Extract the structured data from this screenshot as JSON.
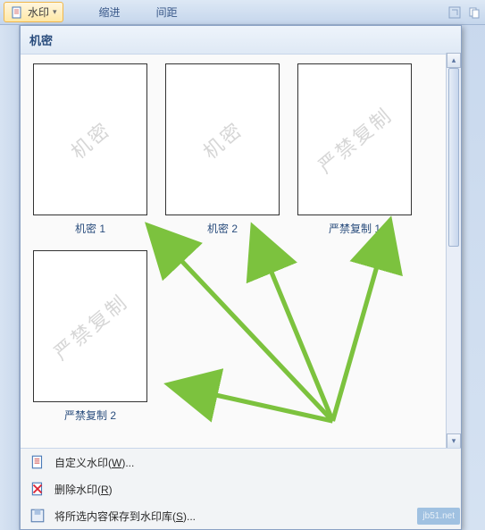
{
  "ribbon": {
    "watermark_btn": "水印",
    "group_indent": "缩进",
    "group_spacing": "间距"
  },
  "panel": {
    "section_title": "机密",
    "thumbs": [
      {
        "wm": "机密",
        "label": "机密 1"
      },
      {
        "wm": "机密",
        "label": "机密 2"
      },
      {
        "wm": "严禁复制",
        "label": "严禁复制 1"
      },
      {
        "wm": "严禁复制",
        "label": "严禁复制 2"
      }
    ]
  },
  "menu": {
    "custom": {
      "text": "自定义水印(",
      "key": "W",
      "suffix": ")..."
    },
    "remove": {
      "text": "删除水印(",
      "key": "R",
      "suffix": ")"
    },
    "save": {
      "text": "将所选内容保存到水印库(",
      "key": "S",
      "suffix": ")..."
    }
  },
  "icons": {
    "page": "page-icon",
    "delete": "delete-icon",
    "save": "save-icon"
  },
  "watermark_site": "jb51.net"
}
